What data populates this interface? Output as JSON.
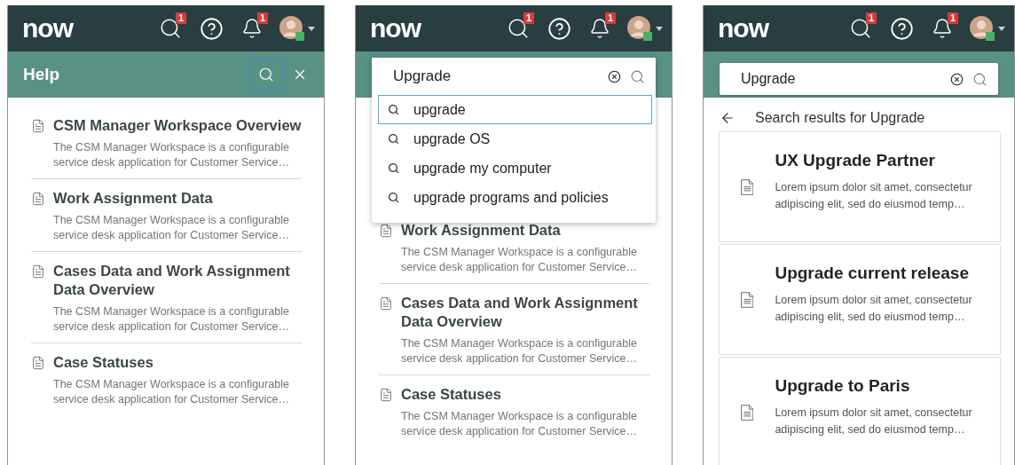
{
  "panels": [
    {
      "kind": "help",
      "header": {
        "logo": "now",
        "icons": [
          {
            "kind": "search",
            "badge": "1"
          },
          {
            "kind": "help"
          },
          {
            "kind": "bell",
            "badge": "1"
          },
          {
            "kind": "avatar"
          }
        ]
      },
      "title_bar": {
        "title": "Help",
        "search_focused": true
      },
      "articles": [
        {
          "title": "CSM Manager Workspace Overview",
          "description": "The CSM Manager Workspace is a configurable service desk application for Customer Service…"
        },
        {
          "title": "Work Assignment Data",
          "description": "The CSM Manager Workspace is a configurable service desk application for Customer Service…"
        },
        {
          "title": "Cases Data and Work Assignment Data Overview",
          "description": "The CSM Manager Workspace is a configurable service desk application for Customer Service…"
        },
        {
          "title": "Case Statuses",
          "description": "The CSM Manager Workspace is a configurable service desk application for Customer Service…"
        }
      ]
    },
    {
      "kind": "suggest",
      "header": {
        "logo": "now",
        "icons": [
          {
            "kind": "search",
            "badge": "1"
          },
          {
            "kind": "help"
          },
          {
            "kind": "bell",
            "badge": "1"
          },
          {
            "kind": "avatar"
          }
        ]
      },
      "search": {
        "value": "Upgrade"
      },
      "suggestions": [
        {
          "text": "upgrade",
          "selected": true
        },
        {
          "text": "upgrade OS",
          "selected": false
        },
        {
          "text": "upgrade my computer",
          "selected": false
        },
        {
          "text": "upgrade programs and policies",
          "selected": false
        }
      ],
      "articles": [
        {
          "title": "Work Assignment Data",
          "description": "The CSM Manager Workspace is a configurable service desk application for Customer Service…"
        },
        {
          "title": "Cases Data and Work Assignment Data Overview",
          "description": "The CSM Manager Workspace is a configurable service desk application for Customer Service…"
        },
        {
          "title": "Case Statuses",
          "description": "The CSM Manager Workspace is a configurable service desk application for Customer Service…"
        }
      ]
    },
    {
      "kind": "results",
      "header": {
        "logo": "now",
        "icons": [
          {
            "kind": "search",
            "badge": "1"
          },
          {
            "kind": "help"
          },
          {
            "kind": "bell",
            "badge": "1"
          },
          {
            "kind": "avatar"
          }
        ]
      },
      "search": {
        "value": "Upgrade"
      },
      "results_heading": "Search results for Upgrade",
      "results": [
        {
          "title": "UX Upgrade Partner",
          "description": "Lorem ipsum dolor sit amet, consectetur adipiscing elit, sed do eiusmod temp…"
        },
        {
          "title": "Upgrade current release",
          "description": "Lorem ipsum dolor sit amet, consectetur adipiscing elit, sed do eiusmod temp…"
        },
        {
          "title": "Upgrade to Paris",
          "description": "Lorem ipsum dolor sit amet, consectetur adipiscing elit, sed do eiusmod temp…"
        }
      ]
    }
  ]
}
